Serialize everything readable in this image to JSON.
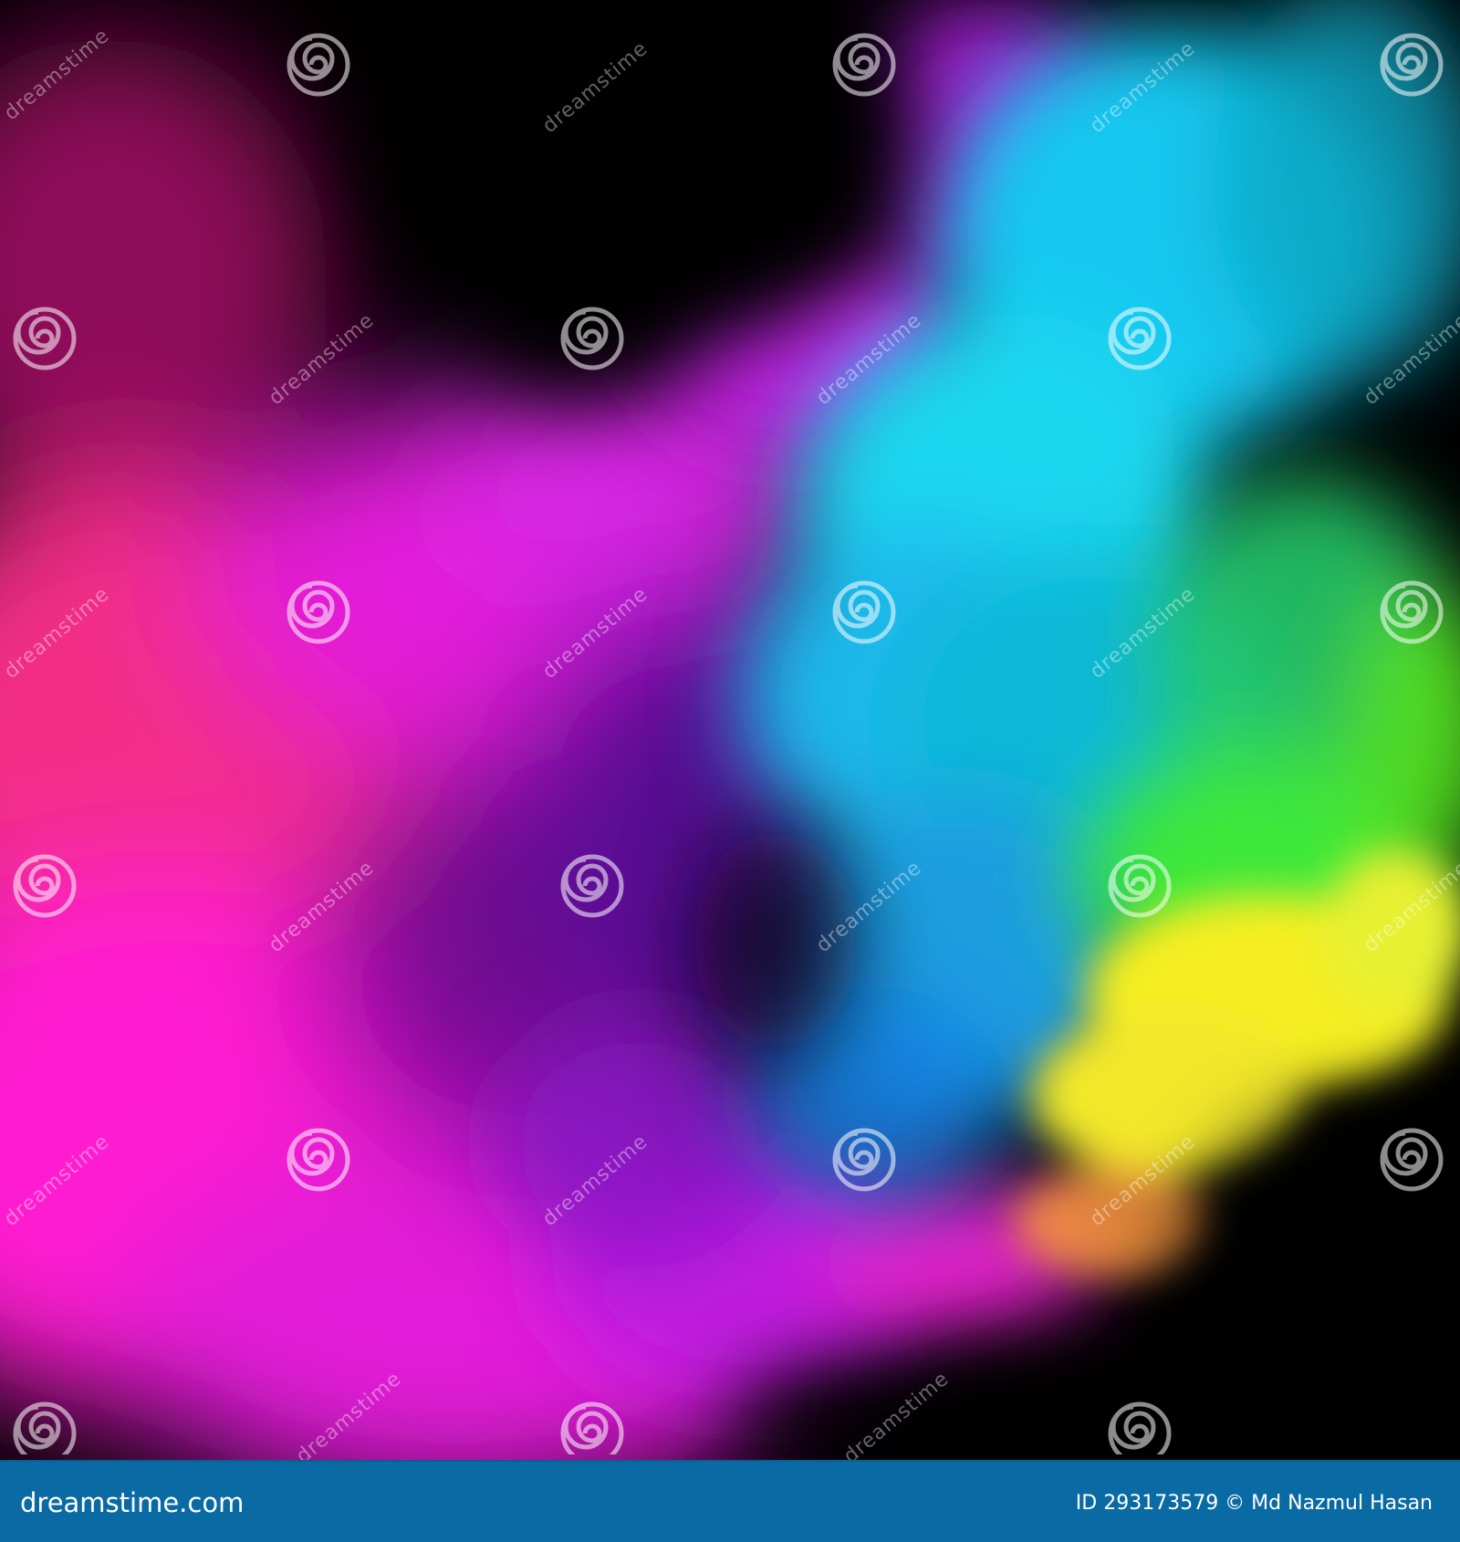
{
  "image": {
    "description_icon": "neon-smoke-photo",
    "colors": {
      "background": "#000000",
      "magenta": "#ff1ad0",
      "pink": "#ff3a8c",
      "violet": "#9b1ee0",
      "cyan": "#1ad6f0",
      "green": "#3ee83a",
      "yellow": "#f4ee22",
      "footer": "#0a6aa3"
    }
  },
  "watermark": {
    "text": "dreamstime",
    "icon": "spiral-logo-icon"
  },
  "footer": {
    "logo_text": "dreamstime.com",
    "credit_text": "ID 293173579 © Md Nazmul  Hasan"
  }
}
